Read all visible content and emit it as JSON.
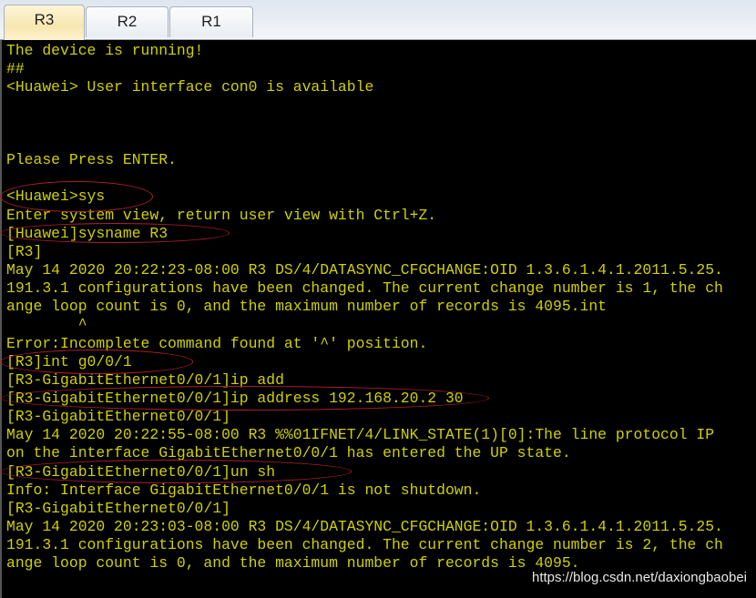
{
  "tabs": [
    {
      "label": "R3",
      "active": true
    },
    {
      "label": "R2",
      "active": false
    },
    {
      "label": "R1",
      "active": false
    }
  ],
  "terminal": {
    "text_color": "#d0d000",
    "lines": [
      "The device is running!",
      "##",
      "<Huawei> User interface con0 is available",
      "",
      "",
      "",
      "Please Press ENTER.",
      "",
      "<Huawei>sys",
      "Enter system view, return user view with Ctrl+Z.",
      "[Huawei]sysname R3",
      "[R3]",
      "May 14 2020 20:22:23-08:00 R3 DS/4/DATASYNC_CFGCHANGE:OID 1.3.6.1.4.1.2011.5.25.",
      "191.3.1 configurations have been changed. The current change number is 1, the ch",
      "ange loop count is 0, and the maximum number of records is 4095.int",
      "        ^",
      "Error:Incomplete command found at '^' position.",
      "[R3]int g0/0/1",
      "[R3-GigabitEthernet0/0/1]ip add",
      "[R3-GigabitEthernet0/0/1]ip address 192.168.20.2 30",
      "[R3-GigabitEthernet0/0/1]",
      "May 14 2020 20:22:55-08:00 R3 %%01IFNET/4/LINK_STATE(1)[0]:The line protocol IP",
      "on the interface GigabitEthernet0/0/1 has entered the UP state.",
      "[R3-GigabitEthernet0/0/1]un sh",
      "Info: Interface GigabitEthernet0/0/1 is not shutdown.",
      "[R3-GigabitEthernet0/0/1]",
      "May 14 2020 20:23:03-08:00 R3 DS/4/DATASYNC_CFGCHANGE:OID 1.3.6.1.4.1.2011.5.25.",
      "191.3.1 configurations have been changed. The current change number is 2, the ch",
      "ange loop count is 0, and the maximum number of records is 4095."
    ]
  },
  "annotation_color": "#b0202a",
  "watermark": "https://blog.csdn.net/daxiongbaobei"
}
